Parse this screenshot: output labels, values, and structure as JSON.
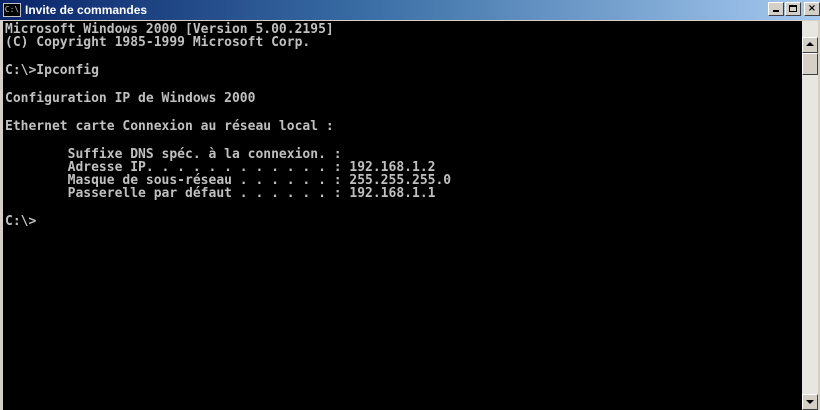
{
  "window": {
    "title": "Invite de commandes",
    "icon": "cmd-icon",
    "close_label": "×"
  },
  "console": {
    "lines": [
      "Microsoft Windows 2000 [Version 5.00.2195]",
      "(C) Copyright 1985-1999 Microsoft Corp.",
      "",
      "C:\\>Ipconfig",
      "",
      "Configuration IP de Windows 2000",
      "",
      "Ethernet carte Connexion au réseau local :",
      "",
      "        Suffixe DNS spéc. à la connexion. :",
      "        Adresse IP. . . . . . . . . . . . : 192.168.1.2",
      "        Masque de sous-réseau . . . . . . : 255.255.255.0",
      "        Passerelle par défaut . . . . . . : 192.168.1.1",
      "",
      "C:\\>"
    ]
  },
  "colors": {
    "console_bg": "#000000",
    "console_text": "#c0c0c0",
    "titlebar_start": "#0a246a",
    "titlebar_end": "#a6caf0"
  }
}
